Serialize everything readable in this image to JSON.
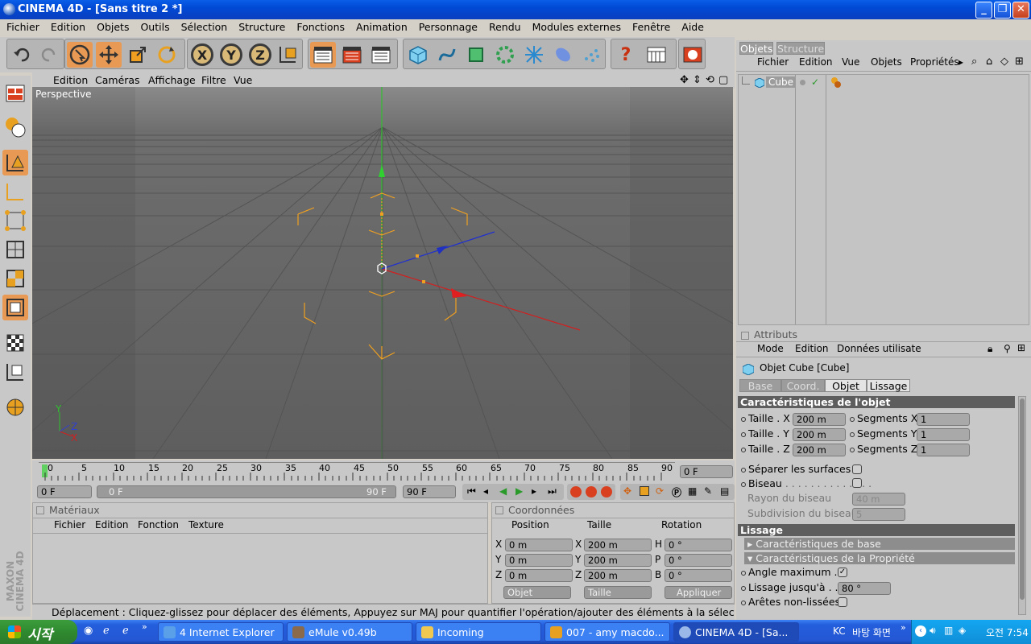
{
  "window": {
    "title": "CINEMA 4D - [Sans titre 2 *]"
  },
  "menubar": [
    "Fichier",
    "Edition",
    "Objets",
    "Outils",
    "Sélection",
    "Structure",
    "Fonctions",
    "Animation",
    "Personnage",
    "Rendu",
    "Modules externes",
    "Fenêtre",
    "Aide"
  ],
  "toolbar": {
    "axis_x": "X",
    "axis_y": "Y",
    "axis_z": "Z",
    "help": "?"
  },
  "viewport": {
    "menu": [
      "Edition",
      "Caméras",
      "Affichage",
      "Filtre",
      "Vue"
    ],
    "label": "Perspective",
    "axis_x": "X",
    "axis_y": "Y",
    "axis_z": "Z"
  },
  "timeline": {
    "ticks": [
      "0",
      "5",
      "10",
      "15",
      "20",
      "25",
      "30",
      "35",
      "40",
      "45",
      "50",
      "55",
      "60",
      "65",
      "70",
      "75",
      "80",
      "85",
      "90"
    ],
    "current_frame": "0 F",
    "start_field": "0 F",
    "range_start": "0 F",
    "range_end": "90 F",
    "end_field": "90 F"
  },
  "materials": {
    "title": "Matériaux",
    "menu": [
      "Fichier",
      "Edition",
      "Fonction",
      "Texture"
    ]
  },
  "coordinates": {
    "title": "Coordonnées",
    "headers": [
      "Position",
      "Taille",
      "Rotation"
    ],
    "rows": [
      {
        "pl": "X",
        "pv": "0 m",
        "sl": "X",
        "sv": "200 m",
        "rl": "H",
        "rv": "0 °"
      },
      {
        "pl": "Y",
        "pv": "0 m",
        "sl": "Y",
        "sv": "200 m",
        "rl": "P",
        "rv": "0 °"
      },
      {
        "pl": "Z",
        "pv": "0 m",
        "sl": "Z",
        "sv": "200 m",
        "rl": "B",
        "rv": "0 °"
      }
    ],
    "mode_select": "Objet",
    "size_select": "Taille",
    "apply": "Appliquer"
  },
  "status": "Déplacement : Cliquez-glissez pour déplacer des éléments, Appuyez sur MAJ pour quantifier l'opération/ajouter des éléments à la sélection en mod",
  "objects_panel": {
    "tabs": [
      "Objets",
      "Structure"
    ],
    "menu": [
      "Fichier",
      "Edition",
      "Vue",
      "Objets",
      "Propriétés"
    ],
    "items": [
      {
        "name": "Cube"
      }
    ]
  },
  "attributes": {
    "title": "Attributs",
    "menu": [
      "Mode",
      "Edition",
      "Données utilisate"
    ],
    "object_title": "Objet Cube [Cube]",
    "tabs": [
      "Base",
      "Coord.",
      "Objet",
      "Lissage"
    ],
    "section_object": "Caractéristiques de l'objet",
    "size_x_label": "Taille . X",
    "size_x": "200 m",
    "size_y_label": "Taille . Y",
    "size_y": "200 m",
    "size_z_label": "Taille . Z",
    "size_z": "200 m",
    "seg_x_label": "Segments X",
    "seg_x": "1",
    "seg_y_label": "Segments Y",
    "seg_y": "1",
    "seg_z_label": "Segments Z",
    "seg_z": "1",
    "separate_label": "Séparer les surfaces",
    "bevel_label": "Biseau",
    "bevel_radius_label": "Rayon du biseau",
    "bevel_radius": "40 m",
    "bevel_subdiv_label": "Subdivision du biseau",
    "bevel_subdiv": "5",
    "section_smoothing": "Lissage",
    "sub_base": "Caractéristiques de base",
    "sub_prop": "Caractéristiques de la Propriété",
    "angle_max_label": "Angle maximum",
    "smooth_to_label": "Lissage jusqu'à",
    "smooth_to": "80 °",
    "edges_label": "Arêtes non-lissées"
  },
  "sidebar_brand": "MAXON CINEMA 4D",
  "taskbar": {
    "start": "시작",
    "tasks": [
      "4 Internet Explorer",
      "eMule v0.49b",
      "Incoming",
      "007 - amy macdo...",
      "CINEMA 4D - [Sa..."
    ],
    "tray_lang": "KC",
    "tray_desktop": "바탕 화면",
    "clock": "오전 7:54"
  },
  "colors": {
    "accent": "#e89a54",
    "viewport": "#6c6c6c",
    "xp_blue": "#245edc"
  }
}
